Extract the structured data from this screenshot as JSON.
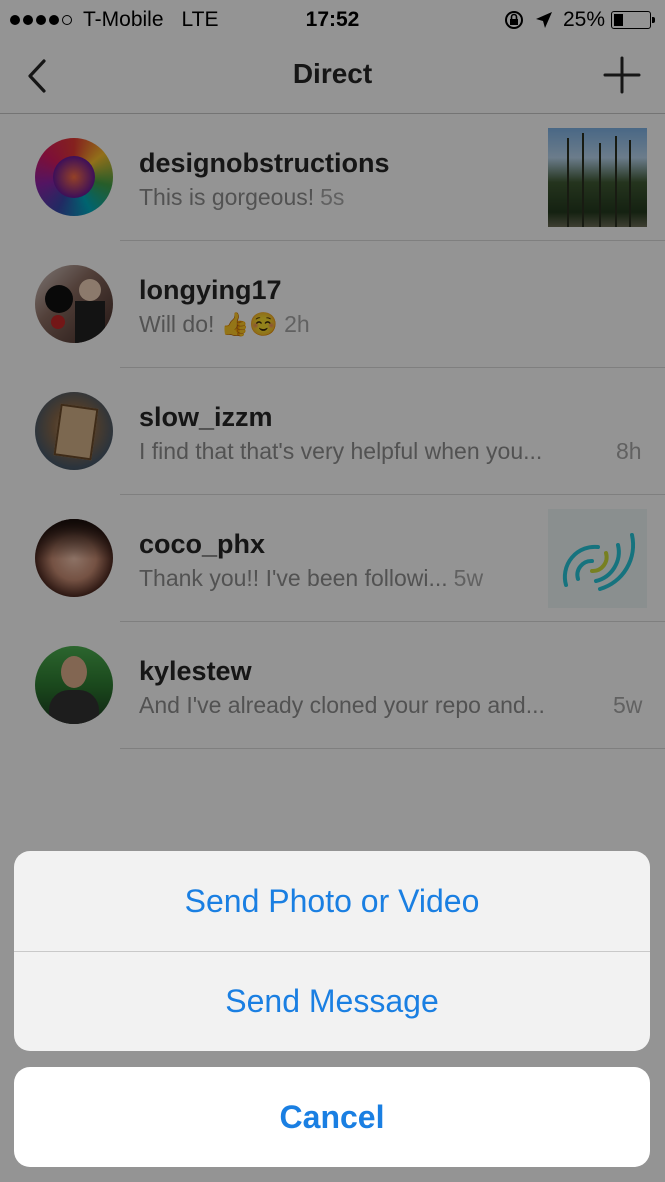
{
  "status_bar": {
    "carrier": "T-Mobile",
    "network": "LTE",
    "time": "17:52",
    "battery": "25%",
    "battery_level": 0.25
  },
  "nav": {
    "title": "Direct",
    "back_icon": "chevron-left-icon",
    "new_icon": "plus-icon"
  },
  "threads": [
    {
      "username": "designobstructions",
      "preview": "This is gorgeous!",
      "time": "5s",
      "thumb": "forest-photo"
    },
    {
      "username": "longying17",
      "preview": "Will do! 👍☺️",
      "time": "2h"
    },
    {
      "username": "slow_izzm",
      "preview": "I find that that's very helpful when you...",
      "time": "8h"
    },
    {
      "username": "coco_phx",
      "preview": "Thank you!! I've been followi...",
      "time": "5w",
      "thumb": "signal-waves"
    },
    {
      "username": "kylestew",
      "preview": "And I've already cloned your repo and...",
      "time": "5w"
    }
  ],
  "action_sheet": {
    "option1": "Send Photo or Video",
    "option2": "Send Message",
    "cancel": "Cancel"
  },
  "colors": {
    "accent": "#1a7fe2",
    "dim_overlay": "rgba(0,0,0,0.42)"
  }
}
